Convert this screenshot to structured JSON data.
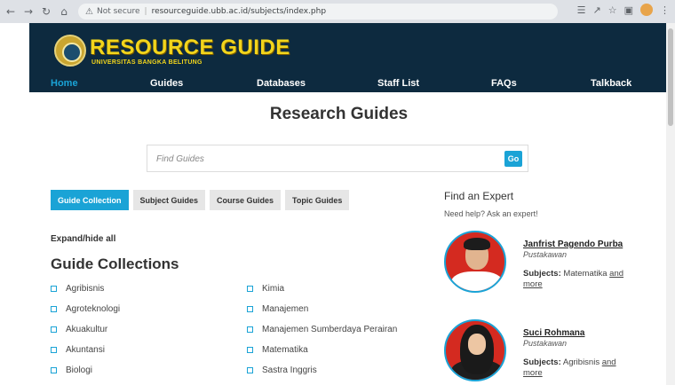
{
  "browser": {
    "security": "Not secure",
    "url": "resourceguide.ubb.ac.id/subjects/index.php"
  },
  "header": {
    "logo_title": "RESOURCE GUIDE",
    "logo_subtitle": "UNIVERSITAS BANGKA BELITUNG",
    "nav": [
      "Home",
      "Guides",
      "Databases",
      "Staff List",
      "FAQs",
      "Talkback"
    ]
  },
  "page": {
    "title": "Research Guides",
    "search_placeholder": "Find Guides",
    "search_button": "Go",
    "tabs": [
      "Guide Collection",
      "Subject Guides",
      "Course Guides",
      "Topic Guides"
    ],
    "expand_all": "Expand/hide all",
    "collections_title": "Guide Collections",
    "collections_left": [
      "Agribisnis",
      "Agroteknologi",
      "Akuakultur",
      "Akuntansi",
      "Biologi"
    ],
    "collections_right": [
      "Kimia",
      "Manajemen",
      "Manajemen Sumberdaya Perairan",
      "Matematika",
      "Sastra Inggris"
    ]
  },
  "experts": {
    "title": "Find an Expert",
    "subtitle": "Need help? Ask an expert!",
    "subjects_label": "Subjects:",
    "and": "and",
    "more": "more",
    "list": [
      {
        "name": "Janfrist Pagendo Purba",
        "role": "Pustakawan",
        "subject": "Matematika"
      },
      {
        "name": "Suci Rohmana",
        "role": "Pustakawan",
        "subject": "Agribisnis"
      }
    ]
  },
  "colors": {
    "header_bg": "#0d2a3f",
    "accent": "#1aa3d6",
    "logo_yellow": "#f2d51c"
  }
}
